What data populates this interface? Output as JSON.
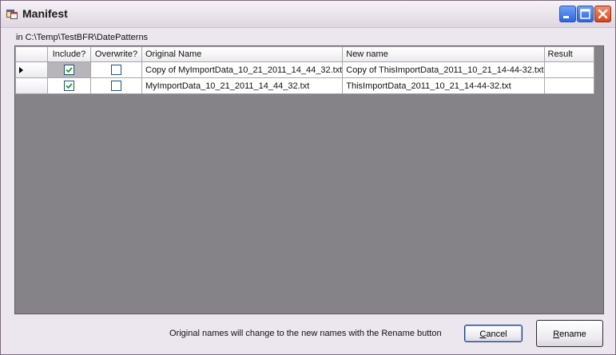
{
  "window": {
    "title": "Manifest",
    "icon": "app-window-icon"
  },
  "path_label": "in C:\\Temp\\TestBFR\\DatePatterns",
  "grid": {
    "columns": [
      "Include?",
      "Overwrite?",
      "Original Name",
      "New name",
      "Result"
    ],
    "rows": [
      {
        "current": true,
        "include": true,
        "overwrite": false,
        "original_name": "Copy of MyImportData_10_21_2011_14_44_32.txt",
        "new_name": "Copy of ThisImportData_2011_10_21_14-44-32.txt",
        "result": ""
      },
      {
        "current": false,
        "include": true,
        "overwrite": false,
        "original_name": "MyImportData_10_21_2011_14_44_32.txt",
        "new_name": "ThisImportData_2011_10_21_14-44-32.txt",
        "result": ""
      }
    ]
  },
  "footer": {
    "hint": "Original names will change to the new names with the Rename button",
    "cancel": {
      "accel": "C",
      "rest": "ancel"
    },
    "rename": {
      "accel": "R",
      "rest": "ename"
    }
  }
}
